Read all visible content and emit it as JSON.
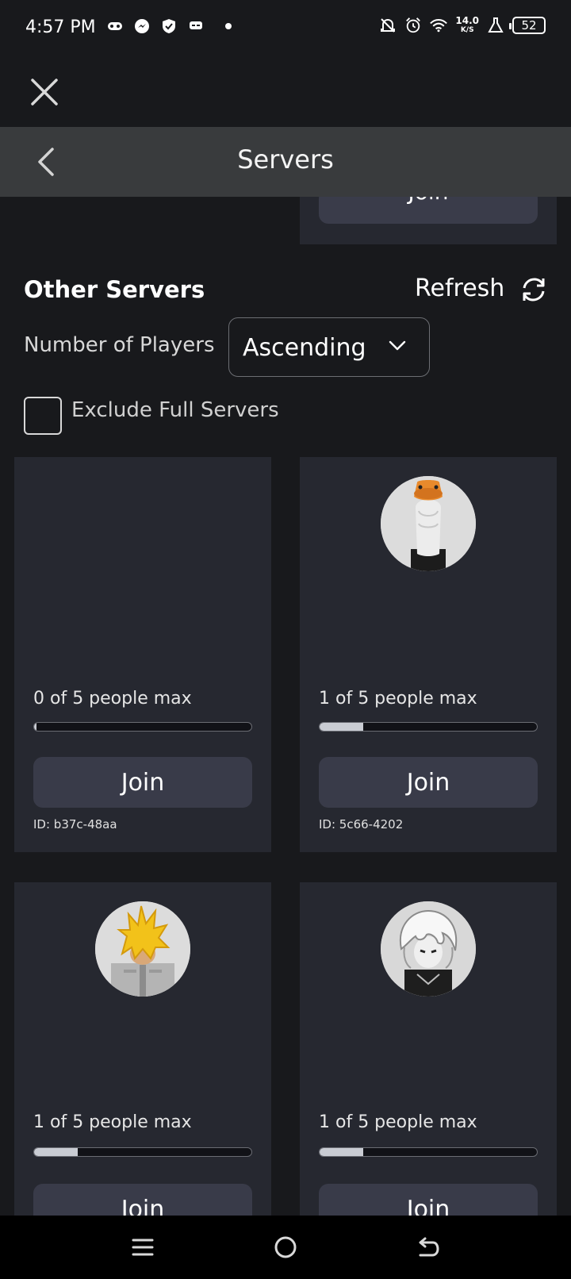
{
  "status_bar": {
    "time": "4:57 PM",
    "left_icons": [
      "game-controller-icon",
      "messenger-icon",
      "shield-icon",
      "chat-icon"
    ],
    "net_speed": "14.0",
    "net_speed_unit": "K/S",
    "battery": "52"
  },
  "header": {
    "title": "Servers"
  },
  "previous_card": {
    "join_label": "Join"
  },
  "section": {
    "title": "Other Servers",
    "refresh_label": "Refresh"
  },
  "sort": {
    "label": "Number of Players",
    "selected": "Ascending"
  },
  "filter": {
    "exclude_full_label": "Exclude Full Servers",
    "checked": false
  },
  "servers": [
    {
      "players_text": "0 of 5 people max",
      "fill": 0.01,
      "join_label": "Join",
      "id": "ID: b37c-48aa",
      "avatar": "none"
    },
    {
      "players_text": "1 of 5 people max",
      "fill": 0.2,
      "join_label": "Join",
      "id": "ID: 5c66-4202",
      "avatar": "goose-avatar"
    },
    {
      "players_text": "1 of 5 people max",
      "fill": 0.2,
      "join_label": "Join",
      "avatar": "spiky-hair-avatar"
    },
    {
      "players_text": "1 of 5 people max",
      "fill": 0.2,
      "join_label": "Join",
      "avatar": "white-hair-avatar"
    }
  ],
  "colors": {
    "background": "#18191c",
    "card": "#262830",
    "header": "#393b3d",
    "button": "#393b49"
  }
}
